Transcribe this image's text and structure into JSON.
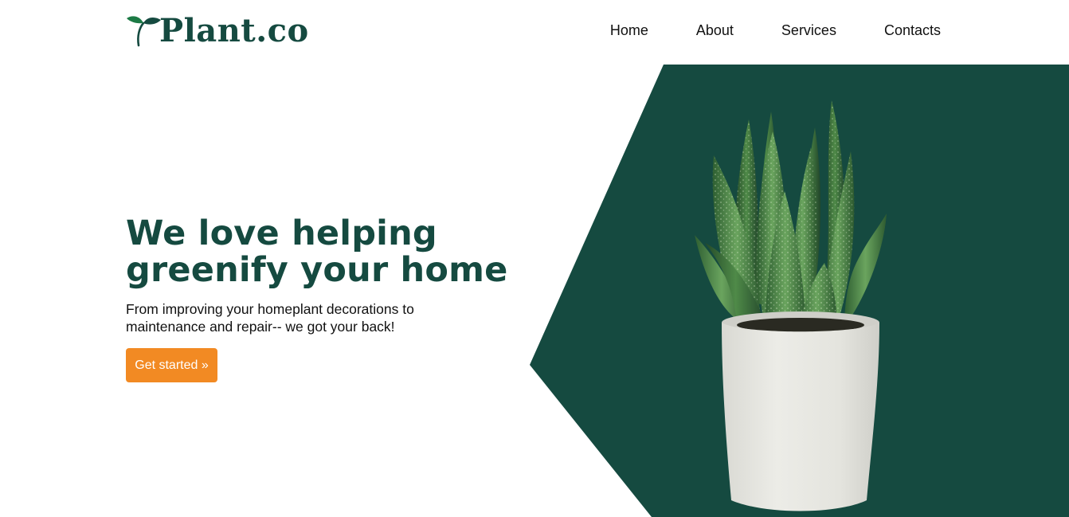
{
  "brand": {
    "name": "Plant.co",
    "logo_icon": "sprout-icon",
    "color": "#154a40"
  },
  "nav": {
    "items": [
      {
        "label": "Home"
      },
      {
        "label": "About"
      },
      {
        "label": "Services"
      },
      {
        "label": "Contacts"
      }
    ]
  },
  "hero": {
    "title_line1": "We love helping",
    "title_line2": "greenify your home",
    "subtitle_line1": "From improving your homeplant decorations to",
    "subtitle_line2": "maintenance and repair-- we got your back!",
    "cta_label": "Get started »",
    "image": "potted-aloe-plant-image"
  },
  "colors": {
    "primary": "#154a40",
    "accent": "#f28a23",
    "background": "#ffffff"
  }
}
